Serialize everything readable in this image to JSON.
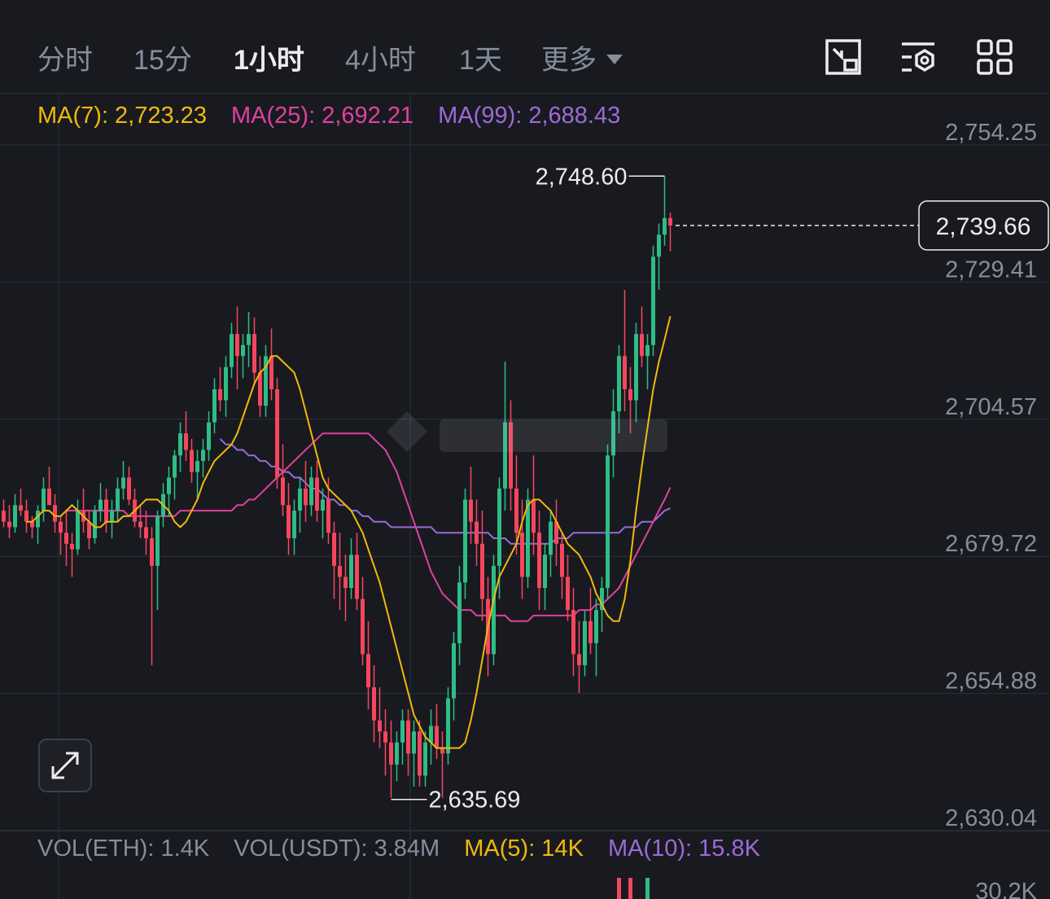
{
  "tabs": [
    {
      "label": "分时",
      "active": false
    },
    {
      "label": "15分",
      "active": false
    },
    {
      "label": "1小时",
      "active": true
    },
    {
      "label": "4小时",
      "active": false
    },
    {
      "label": "1天",
      "active": false
    },
    {
      "label": "更多",
      "active": false
    }
  ],
  "tools": [
    "chart-settings-icon",
    "indicator-settings-icon",
    "grid-layout-icon"
  ],
  "ma_legend": {
    "ma7": "MA(7): 2,723.23",
    "ma25": "MA(25): 2,692.21",
    "ma99": "MA(99): 2,688.43"
  },
  "vol_legend": {
    "eth": "VOL(ETH): 1.4K",
    "usdt": "VOL(USDT): 3.84M",
    "ma5": "MA(5): 14K",
    "ma10": "MA(10): 15.8K"
  },
  "colors": {
    "up": "#2ebd85",
    "down": "#f6465d",
    "ma7": "#f0b90b",
    "ma25": "#e040a0",
    "ma99": "#9c6ad6",
    "background": "#181a20"
  },
  "chart_data": {
    "type": "candlestick",
    "y_axis_ticks": [
      "2,754.25",
      "2,729.41",
      "2,704.57",
      "2,679.72",
      "2,654.88",
      "2,630.04"
    ],
    "y_axis_tick_values": [
      2754.25,
      2729.41,
      2704.57,
      2679.72,
      2654.88,
      2630.04
    ],
    "volume_axis_tick": "30.2K",
    "current_price": "2,739.66",
    "current_price_value": 2739.66,
    "high_label": "2,748.60",
    "high_value": 2748.6,
    "low_label": "2,635.69",
    "low_value": 2635.69,
    "candles_ohlc": [
      [
        2688,
        2690,
        2685,
        2686
      ],
      [
        2686,
        2689,
        2683,
        2685
      ],
      [
        2685,
        2691,
        2684,
        2689
      ],
      [
        2689,
        2692,
        2687,
        2688
      ],
      [
        2688,
        2690,
        2684,
        2686
      ],
      [
        2686,
        2687,
        2683,
        2685
      ],
      [
        2685,
        2689,
        2682,
        2688
      ],
      [
        2688,
        2694,
        2686,
        2692
      ],
      [
        2692,
        2696,
        2690,
        2689
      ],
      [
        2689,
        2691,
        2684,
        2686
      ],
      [
        2686,
        2687,
        2680,
        2684
      ],
      [
        2684,
        2688,
        2678,
        2682
      ],
      [
        2682,
        2684,
        2676,
        2681
      ],
      [
        2681,
        2690,
        2680,
        2688
      ],
      [
        2688,
        2692,
        2684,
        2686
      ],
      [
        2686,
        2688,
        2681,
        2683
      ],
      [
        2683,
        2689,
        2682,
        2688
      ],
      [
        2688,
        2693,
        2686,
        2690
      ],
      [
        2690,
        2692,
        2684,
        2686
      ],
      [
        2686,
        2690,
        2683,
        2688
      ],
      [
        2688,
        2694,
        2686,
        2692
      ],
      [
        2692,
        2697,
        2690,
        2694
      ],
      [
        2694,
        2696,
        2689,
        2690
      ],
      [
        2690,
        2692,
        2685,
        2686
      ],
      [
        2686,
        2689,
        2683,
        2685
      ],
      [
        2685,
        2688,
        2680,
        2683
      ],
      [
        2683,
        2685,
        2660,
        2678
      ],
      [
        2678,
        2688,
        2670,
        2687
      ],
      [
        2687,
        2693,
        2685,
        2691
      ],
      [
        2691,
        2696,
        2687,
        2694
      ],
      [
        2694,
        2699,
        2690,
        2698
      ],
      [
        2698,
        2704,
        2695,
        2702
      ],
      [
        2702,
        2706,
        2697,
        2699
      ],
      [
        2699,
        2701,
        2693,
        2695
      ],
      [
        2695,
        2699,
        2690,
        2697
      ],
      [
        2697,
        2701,
        2694,
        2699
      ],
      [
        2699,
        2706,
        2697,
        2704
      ],
      [
        2704,
        2712,
        2702,
        2710
      ],
      [
        2710,
        2714,
        2706,
        2708
      ],
      [
        2708,
        2716,
        2705,
        2714
      ],
      [
        2714,
        2722,
        2712,
        2720
      ],
      [
        2720,
        2725,
        2710,
        2716
      ],
      [
        2716,
        2720,
        2712,
        2718
      ],
      [
        2718,
        2724,
        2714,
        2720
      ],
      [
        2720,
        2723,
        2711,
        2713
      ],
      [
        2713,
        2716,
        2705,
        2707
      ],
      [
        2707,
        2718,
        2705,
        2716
      ],
      [
        2716,
        2721,
        2708,
        2710
      ],
      [
        2710,
        2712,
        2692,
        2694
      ],
      [
        2694,
        2700,
        2687,
        2689
      ],
      [
        2689,
        2693,
        2680,
        2683
      ],
      [
        2683,
        2690,
        2680,
        2688
      ],
      [
        2688,
        2694,
        2684,
        2692
      ],
      [
        2692,
        2697,
        2686,
        2689
      ],
      [
        2689,
        2696,
        2687,
        2694
      ],
      [
        2694,
        2697,
        2686,
        2688
      ],
      [
        2688,
        2692,
        2683,
        2690
      ],
      [
        2690,
        2694,
        2682,
        2684
      ],
      [
        2684,
        2686,
        2672,
        2678
      ],
      [
        2678,
        2684,
        2670,
        2676
      ],
      [
        2676,
        2680,
        2668,
        2674
      ],
      [
        2674,
        2683,
        2672,
        2680
      ],
      [
        2680,
        2684,
        2670,
        2672
      ],
      [
        2672,
        2676,
        2660,
        2662
      ],
      [
        2662,
        2668,
        2652,
        2656
      ],
      [
        2656,
        2660,
        2646,
        2650
      ],
      [
        2650,
        2656,
        2645,
        2648
      ],
      [
        2648,
        2652,
        2640,
        2646
      ],
      [
        2646,
        2650,
        2636,
        2642
      ],
      [
        2642,
        2648,
        2639,
        2646
      ],
      [
        2646,
        2652,
        2642,
        2650
      ],
      [
        2650,
        2652,
        2640,
        2644
      ],
      [
        2644,
        2650,
        2638,
        2648
      ],
      [
        2648,
        2650,
        2638,
        2640
      ],
      [
        2640,
        2648,
        2638,
        2646
      ],
      [
        2646,
        2652,
        2642,
        2649
      ],
      [
        2649,
        2653,
        2643,
        2645
      ],
      [
        2645,
        2648,
        2636,
        2644
      ],
      [
        2644,
        2656,
        2642,
        2654
      ],
      [
        2654,
        2666,
        2650,
        2664
      ],
      [
        2664,
        2678,
        2660,
        2675
      ],
      [
        2675,
        2692,
        2672,
        2690
      ],
      [
        2690,
        2696,
        2682,
        2686
      ],
      [
        2686,
        2690,
        2678,
        2682
      ],
      [
        2682,
        2688,
        2668,
        2672
      ],
      [
        2672,
        2676,
        2658,
        2662
      ],
      [
        2662,
        2680,
        2660,
        2678
      ],
      [
        2678,
        2694,
        2672,
        2692
      ],
      [
        2692,
        2715,
        2688,
        2704
      ],
      [
        2704,
        2708,
        2688,
        2692
      ],
      [
        2692,
        2698,
        2680,
        2684
      ],
      [
        2684,
        2690,
        2672,
        2676
      ],
      [
        2676,
        2692,
        2674,
        2690
      ],
      [
        2690,
        2698,
        2680,
        2684
      ],
      [
        2684,
        2688,
        2670,
        2674
      ],
      [
        2674,
        2682,
        2670,
        2680
      ],
      [
        2680,
        2688,
        2676,
        2686
      ],
      [
        2686,
        2690,
        2678,
        2682
      ],
      [
        2682,
        2684,
        2672,
        2676
      ],
      [
        2676,
        2680,
        2668,
        2670
      ],
      [
        2670,
        2674,
        2658,
        2662
      ],
      [
        2662,
        2668,
        2655,
        2660
      ],
      [
        2660,
        2670,
        2658,
        2668
      ],
      [
        2668,
        2674,
        2662,
        2664
      ],
      [
        2664,
        2672,
        2658,
        2670
      ],
      [
        2670,
        2676,
        2666,
        2674
      ],
      [
        2674,
        2700,
        2672,
        2698
      ],
      [
        2698,
        2710,
        2694,
        2706
      ],
      [
        2706,
        2718,
        2702,
        2716
      ],
      [
        2716,
        2728,
        2706,
        2710
      ],
      [
        2710,
        2714,
        2702,
        2708
      ],
      [
        2708,
        2722,
        2704,
        2720
      ],
      [
        2720,
        2725,
        2714,
        2716
      ],
      [
        2716,
        2720,
        2710,
        2718
      ],
      [
        2718,
        2736,
        2716,
        2734
      ],
      [
        2734,
        2740,
        2728,
        2738
      ],
      [
        2738,
        2748.6,
        2736,
        2741
      ],
      [
        2741,
        2742,
        2735,
        2739.66
      ]
    ],
    "ma7_line": [
      2686,
      2686,
      2687,
      2688,
      2688,
      2687,
      2687,
      2688,
      2689,
      2688,
      2687,
      2686,
      2685,
      2685,
      2686,
      2686,
      2686,
      2687,
      2687,
      2688,
      2689,
      2690,
      2690,
      2690,
      2689,
      2688,
      2686,
      2685,
      2686,
      2688,
      2690,
      2693,
      2695,
      2697,
      2698,
      2699,
      2700,
      2702,
      2705,
      2708,
      2711,
      2713,
      2714,
      2716,
      2716,
      2715,
      2714,
      2713,
      2710,
      2706,
      2702,
      2698,
      2694,
      2692,
      2691,
      2690,
      2689,
      2688,
      2686,
      2684,
      2681,
      2678,
      2675,
      2671,
      2667,
      2663,
      2659,
      2655,
      2651,
      2649,
      2647,
      2646,
      2645,
      2645,
      2645,
      2645,
      2645,
      2646,
      2650,
      2655,
      2661,
      2667,
      2672,
      2676,
      2678,
      2680,
      2682,
      2686,
      2689,
      2690,
      2690,
      2689,
      2688,
      2686,
      2684,
      2682,
      2681,
      2680,
      2678,
      2676,
      2673,
      2671,
      2669,
      2668,
      2668,
      2672,
      2679,
      2688,
      2696,
      2703,
      2710,
      2715,
      2719,
      2723.23
    ],
    "ma25_line": [
      2688,
      2688,
      2688,
      2688,
      2688,
      2688,
      2688,
      2688,
      2688,
      2688,
      2688,
      2687,
      2687,
      2687,
      2687,
      2687,
      2687,
      2687,
      2687,
      2687,
      2688,
      2688,
      2688,
      2688,
      2688,
      2688,
      2688,
      2688,
      2688,
      2688,
      2689,
      2689,
      2690,
      2690,
      2691,
      2692,
      2693,
      2694,
      2695,
      2696,
      2697,
      2698,
      2699,
      2700,
      2701,
      2702,
      2702,
      2702,
      2702,
      2702,
      2702,
      2702,
      2702,
      2702,
      2701,
      2700,
      2699,
      2697,
      2695,
      2692,
      2689,
      2686,
      2683,
      2680,
      2677,
      2675,
      2673,
      2672,
      2671,
      2670,
      2670,
      2670,
      2669,
      2669,
      2669,
      2669,
      2669,
      2669,
      2668,
      2668,
      2668,
      2668,
      2669,
      2669,
      2669,
      2669,
      2669,
      2669,
      2669,
      2669,
      2670,
      2670,
      2670,
      2671,
      2671,
      2672,
      2673,
      2674,
      2676,
      2678,
      2680,
      2682,
      2684,
      2686,
      2688,
      2690,
      2692.21
    ],
    "ma99_line": [
      2701,
      2700,
      2700,
      2699,
      2699,
      2698,
      2698,
      2697,
      2697,
      2696,
      2696,
      2695,
      2695,
      2694,
      2694,
      2693,
      2692,
      2692,
      2691,
      2690,
      2690,
      2689,
      2689,
      2688,
      2688,
      2687,
      2687,
      2686,
      2686,
      2686,
      2685,
      2685,
      2685,
      2685,
      2685,
      2685,
      2685,
      2685,
      2684,
      2684,
      2684,
      2684,
      2684,
      2684,
      2684,
      2684,
      2684,
      2684,
      2683,
      2683,
      2683,
      2682,
      2682,
      2682,
      2682,
      2682,
      2682,
      2682,
      2682,
      2683,
      2683,
      2683,
      2684,
      2684,
      2684,
      2684,
      2684,
      2684,
      2684,
      2684,
      2684,
      2685,
      2685,
      2685,
      2686,
      2686,
      2686,
      2687,
      2688,
      2688.43
    ],
    "volume_bars_visible": [
      {
        "index": 108,
        "direction": "down"
      },
      {
        "index": 110,
        "direction": "down"
      },
      {
        "index": 113,
        "direction": "up"
      }
    ]
  }
}
